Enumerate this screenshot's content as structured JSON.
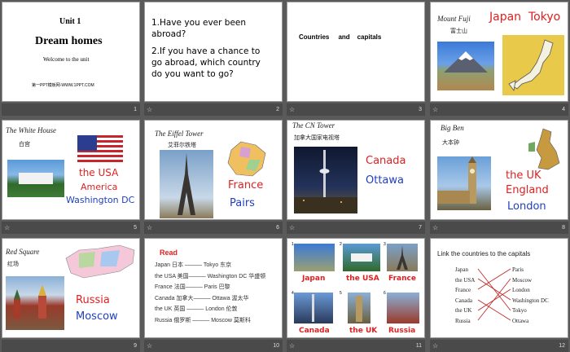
{
  "slides": [
    {
      "num": "1",
      "title": "Unit 1",
      "subtitle": "Dream homes",
      "tagline": "Welcome to the unit",
      "site": "第一PPT模板网-WWW.1PPT.COM"
    },
    {
      "num": "2",
      "q1": "1.Have you ever been",
      "q1b": "abroad?",
      "q2": "2.If you have a chance to",
      "q2b": "go abroad, which country",
      "q2c": "do you want to go?"
    },
    {
      "num": "3",
      "heading": "Countries     and    capitals"
    },
    {
      "num": "4",
      "landmark": "Mount Fuji",
      "landmark_cn": "富士山",
      "country": "Japan",
      "capital": "Tokyo"
    },
    {
      "num": "5",
      "landmark": "The White House",
      "landmark_cn": "白宫",
      "country": "the USA",
      "country2": "America",
      "capital": "Washington DC"
    },
    {
      "num": "6",
      "landmark": "The Eiffel Tower",
      "landmark_cn": "艾菲尔铁塔",
      "country": "France",
      "capital": "Pairs"
    },
    {
      "num": "7",
      "landmark": "The CN Tower",
      "landmark_cn": "加拿大国家电视塔",
      "country": "Canada",
      "capital": "Ottawa"
    },
    {
      "num": "8",
      "landmark": "Big Ben",
      "landmark_cn": "大本钟",
      "country": "the UK",
      "country2": "England",
      "capital": "London"
    },
    {
      "num": "9",
      "landmark": "Red Square",
      "landmark_cn": "红场",
      "country": "Russia",
      "capital": "Moscow"
    },
    {
      "num": "10",
      "heading": "Read",
      "rows": [
        "Japan 日本 ——— Tokyo 东京",
        "the USA 美国——— Washington DC 华盛顿",
        "France 法国——— Paris 巴黎",
        "Canada 加拿大——— Ottawa 渥太华",
        "the UK 英国 ——— London 伦敦",
        "Russia 俄罗斯 ——— Moscow 莫斯科"
      ]
    },
    {
      "num": "11",
      "labels": [
        "Japan",
        "the USA",
        "France",
        "Canada",
        "the UK",
        "Russia"
      ],
      "idx": [
        "1",
        "2",
        "3",
        "4",
        "5",
        "6"
      ]
    },
    {
      "num": "12",
      "heading": "Link the countries to the capitals",
      "left": [
        "Japan",
        "the USA",
        "France",
        "Canada",
        "the UK",
        "Russia"
      ],
      "right": [
        "Paris",
        "Moscow",
        "London",
        "Washington DC",
        "Tokyo",
        "Ottawa"
      ]
    }
  ],
  "colors": {
    "red": "#e02020",
    "blue": "#1f3fc0"
  }
}
